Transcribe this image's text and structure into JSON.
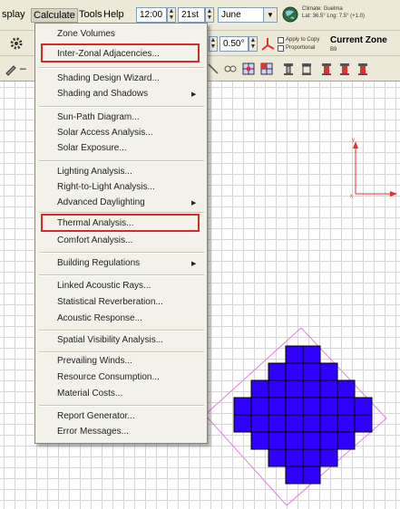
{
  "menubar": {
    "items": [
      "splay",
      "Calculate",
      "Tools",
      "Help"
    ],
    "time_value": "12:00",
    "day_value": "21st",
    "month_value": "June",
    "climate_line1": "Climate: Guelma",
    "climate_line2": "Lat: 36.5°   Lng: 7.5° (+1.0)"
  },
  "toolbar2": {
    "angle_value": "0.50°",
    "apply_to_copy": "Apply to Copy",
    "proportional": "Proportional",
    "current_zone_label": "Current Zone",
    "current_zone_value": "B9"
  },
  "dropdown": {
    "items": [
      {
        "label": "Zone Volumes"
      },
      {
        "label": "Inter-Zonal Adjacencies...",
        "highlighted": true
      },
      {
        "label": "Shading Design Wizard..."
      },
      {
        "label": "Shading and Shadows",
        "submenu": true
      },
      {
        "label": "Sun-Path Diagram..."
      },
      {
        "label": "Solar Access Analysis..."
      },
      {
        "label": "Solar Exposure..."
      },
      {
        "label": "Lighting Analysis..."
      },
      {
        "label": "Right-to-Light Analysis..."
      },
      {
        "label": "Advanced Daylighting",
        "submenu": true
      },
      {
        "label": "Thermal Analysis...",
        "highlighted": true
      },
      {
        "label": "Comfort Analysis..."
      },
      {
        "label": "Building Regulations",
        "submenu": true
      },
      {
        "label": "Linked Acoustic Rays..."
      },
      {
        "label": "Statistical Reverberation..."
      },
      {
        "label": "Acoustic Response..."
      },
      {
        "label": "Spatial Visibility Analysis..."
      },
      {
        "label": "Prevailing Winds..."
      },
      {
        "label": "Resource Consumption..."
      },
      {
        "label": "Material Costs..."
      },
      {
        "label": "Report Generator..."
      },
      {
        "label": "Error Messages..."
      }
    ],
    "highlight_color": "#d42a2a"
  },
  "canvas": {
    "axis_y_label": "y",
    "axis_x_label": "x",
    "axis_color": "#e03030",
    "zone_fill_color": "#3000ff",
    "zone_outline_color": "#e080e0"
  }
}
